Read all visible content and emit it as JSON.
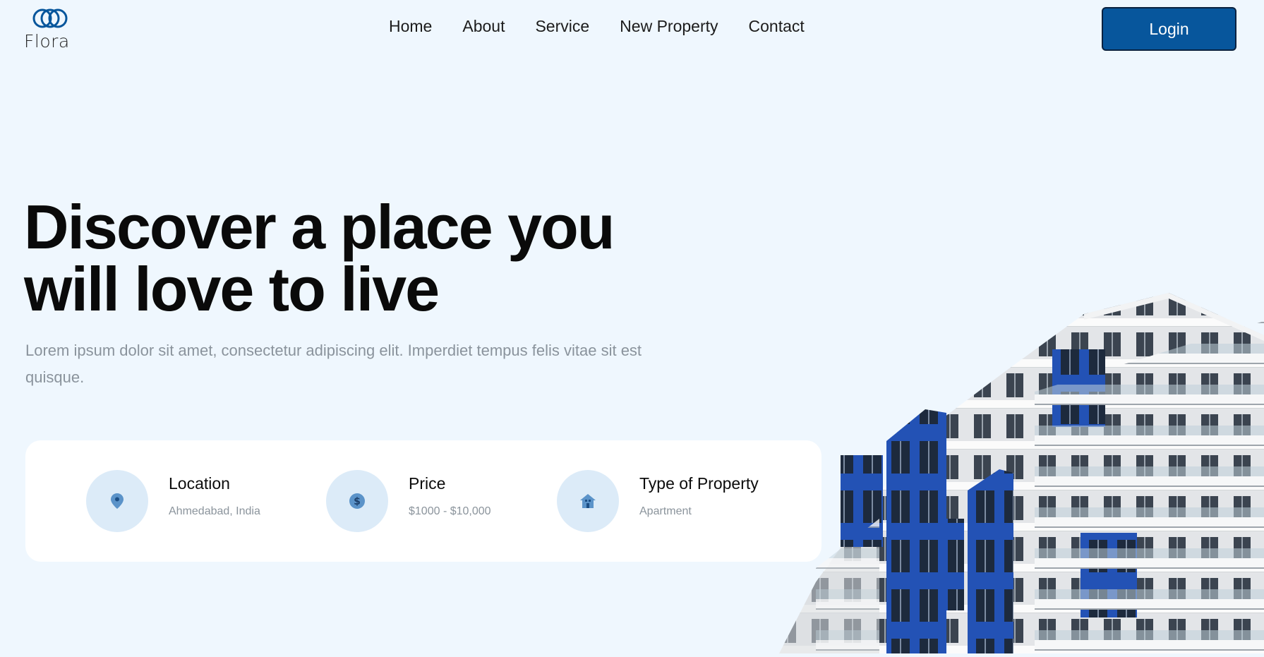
{
  "brand": {
    "name": "Flora",
    "logo_icon": "interlocking-rings-logo",
    "color": "#07569c"
  },
  "nav": {
    "items": [
      "Home",
      "About",
      "Service",
      "New Property",
      "Contact"
    ],
    "login_label": "Login"
  },
  "hero": {
    "title_line1": "Discover a place you",
    "title_line2": "will love to live",
    "subtitle": "Lorem ipsum dolor sit amet, consectetur adipiscing elit. Imperdiet tempus felis vitae sit est quisque."
  },
  "search": {
    "location": {
      "icon": "map-pin-icon",
      "title": "Location",
      "value": "Ahmedabad, India"
    },
    "price": {
      "icon": "dollar-icon",
      "title": "Price",
      "value": "$1000 - $10,000"
    },
    "type": {
      "icon": "house-icon",
      "title": "Type of Property",
      "value": "Apartment"
    }
  },
  "colors": {
    "background": "#eff7fe",
    "accent": "#07569c",
    "icon_bg": "#dcebf8",
    "building_blue": "#1f55b8"
  }
}
